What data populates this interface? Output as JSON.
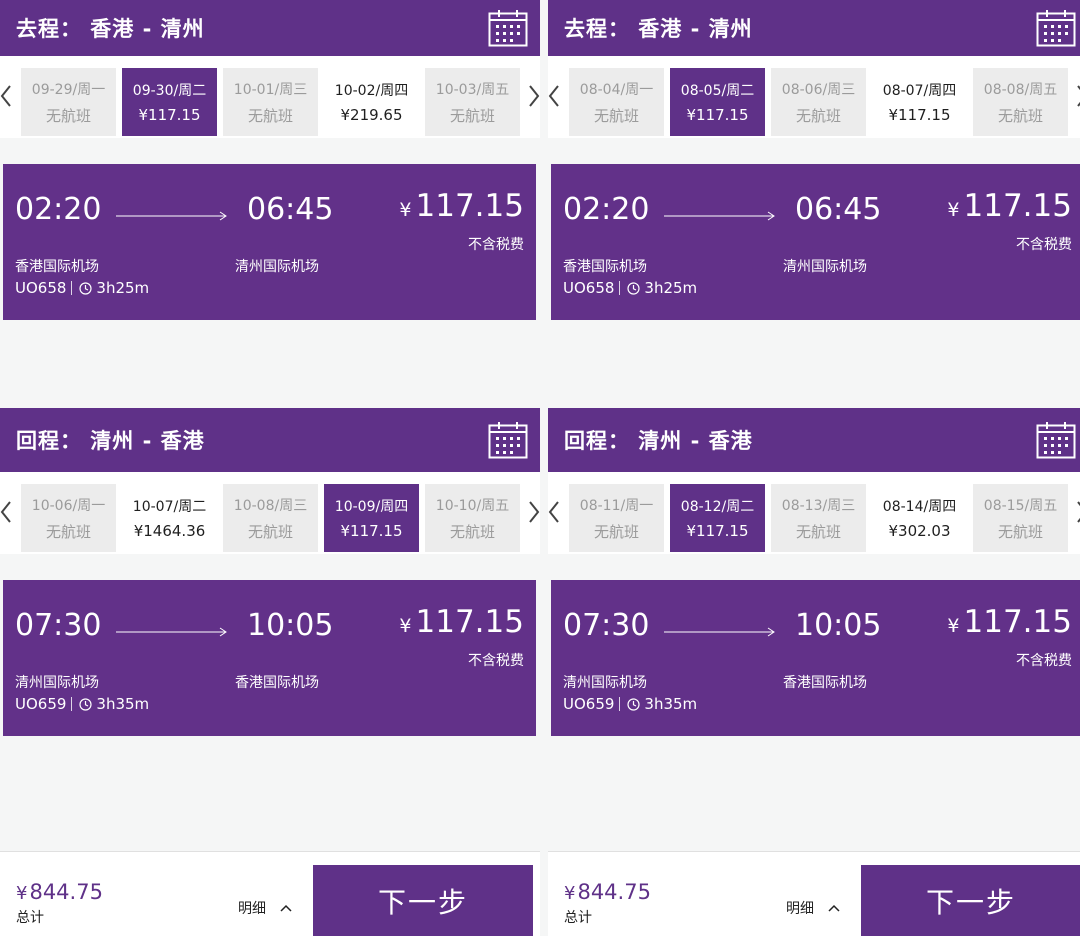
{
  "panels": [
    {
      "outbound": {
        "title": "去程：  香港 - 清州",
        "dates": [
          {
            "date": "09-29/周一",
            "price": "无航班",
            "state": "none"
          },
          {
            "date": "09-30/周二",
            "price": "¥117.15",
            "state": "selected"
          },
          {
            "date": "10-01/周三",
            "price": "无航班",
            "state": "none"
          },
          {
            "date": "10-02/周四",
            "price": "¥219.65",
            "state": "priced"
          },
          {
            "date": "10-03/周五",
            "price": "无航班",
            "state": "none"
          }
        ],
        "flight": {
          "dep_time": "02:20",
          "arr_time": "06:45",
          "price": "117.15",
          "price_symbol": "¥",
          "tax_note": "不含税费",
          "dep_airport": "香港国际机场",
          "arr_airport": "清州国际机场",
          "flight_no": "UO658",
          "duration": "3h25m"
        }
      },
      "return": {
        "title": "回程：  清州 - 香港",
        "dates": [
          {
            "date": "10-06/周一",
            "price": "无航班",
            "state": "none"
          },
          {
            "date": "10-07/周二",
            "price": "¥1464.36",
            "state": "priced"
          },
          {
            "date": "10-08/周三",
            "price": "无航班",
            "state": "none"
          },
          {
            "date": "10-09/周四",
            "price": "¥117.15",
            "state": "selected"
          },
          {
            "date": "10-10/周五",
            "price": "无航班",
            "state": "none"
          }
        ],
        "flight": {
          "dep_time": "07:30",
          "arr_time": "10:05",
          "price": "117.15",
          "price_symbol": "¥",
          "tax_note": "不含税费",
          "dep_airport": "清州国际机场",
          "arr_airport": "香港国际机场",
          "flight_no": "UO659",
          "duration": "3h35m"
        }
      },
      "footer": {
        "total_symbol": "¥",
        "total": "844.75",
        "total_label": "总计",
        "detail_label": "明细",
        "next_label": "下一步"
      }
    },
    {
      "outbound": {
        "title": "去程：  香港 - 清州",
        "dates": [
          {
            "date": "08-04/周一",
            "price": "无航班",
            "state": "none"
          },
          {
            "date": "08-05/周二",
            "price": "¥117.15",
            "state": "selected"
          },
          {
            "date": "08-06/周三",
            "price": "无航班",
            "state": "none"
          },
          {
            "date": "08-07/周四",
            "price": "¥117.15",
            "state": "priced"
          },
          {
            "date": "08-08/周五",
            "price": "无航班",
            "state": "none"
          }
        ],
        "flight": {
          "dep_time": "02:20",
          "arr_time": "06:45",
          "price": "117.15",
          "price_symbol": "¥",
          "tax_note": "不含税费",
          "dep_airport": "香港国际机场",
          "arr_airport": "清州国际机场",
          "flight_no": "UO658",
          "duration": "3h25m"
        }
      },
      "return": {
        "title": "回程：  清州 - 香港",
        "dates": [
          {
            "date": "08-11/周一",
            "price": "无航班",
            "state": "none"
          },
          {
            "date": "08-12/周二",
            "price": "¥117.15",
            "state": "selected"
          },
          {
            "date": "08-13/周三",
            "price": "无航班",
            "state": "none"
          },
          {
            "date": "08-14/周四",
            "price": "¥302.03",
            "state": "priced"
          },
          {
            "date": "08-15/周五",
            "price": "无航班",
            "state": "none"
          }
        ],
        "flight": {
          "dep_time": "07:30",
          "arr_time": "10:05",
          "price": "117.15",
          "price_symbol": "¥",
          "tax_note": "不含税费",
          "dep_airport": "清州国际机场",
          "arr_airport": "香港国际机场",
          "flight_no": "UO659",
          "duration": "3h35m"
        }
      },
      "footer": {
        "total_symbol": "¥",
        "total": "844.75",
        "total_label": "总计",
        "detail_label": "明细",
        "next_label": "下一步"
      }
    }
  ],
  "colors": {
    "brand": "#5f3188",
    "card": "#623189",
    "disabled_text": "#9b9b9b",
    "background": "#f5f6f6"
  },
  "icons": [
    "calendar-icon",
    "chevron-left-icon",
    "chevron-right-icon",
    "clock-icon",
    "chevron-up-icon",
    "arrow-right-icon"
  ]
}
